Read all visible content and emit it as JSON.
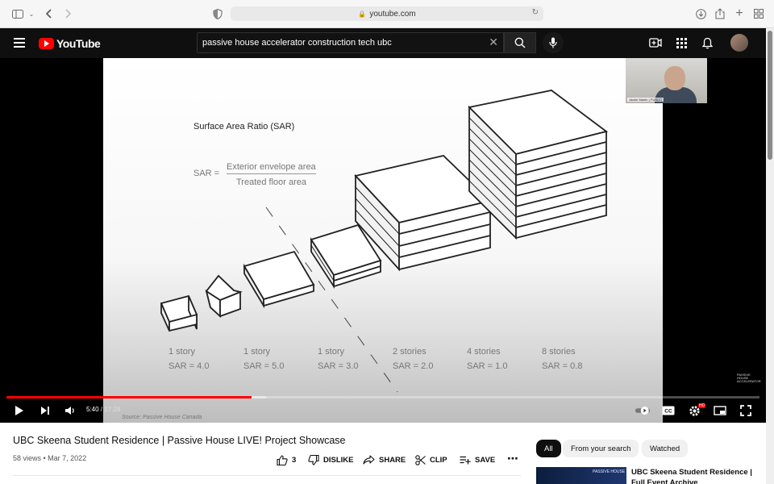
{
  "browser": {
    "url": "youtube.com"
  },
  "masthead": {
    "logo_text": "YouTube",
    "search_query": "passive house accelerator construction tech ubc"
  },
  "player": {
    "current_time": "5:40",
    "duration": " / 17:28",
    "progress_fraction": 0.325,
    "buffer_fraction": 0.345,
    "hd_badge": "HD",
    "webcam_caption": "Jackie Martin | PUBLIC",
    "corner_watermark": "PASSIVE HOUSE ACCELERATOR",
    "source_note": "Source: Passive House Canada",
    "slide": {
      "title": "Surface Area Ratio (SAR)",
      "formula_prefix": "SAR =",
      "numerator": "Exterior envelope area",
      "denominator": "Treated floor area",
      "buildings": [
        {
          "label": "1 story",
          "sar": "SAR = 4.0"
        },
        {
          "label": "1 story",
          "sar": "SAR = 5.0"
        },
        {
          "label": "1 story",
          "sar": "SAR = 3.0"
        },
        {
          "label": "2 stories",
          "sar": "SAR = 2.0"
        },
        {
          "label": "4 stories",
          "sar": "SAR = 1.0"
        },
        {
          "label": "8 stories",
          "sar": "SAR = 0.8"
        }
      ]
    }
  },
  "video": {
    "title": "UBC Skeena Student Residence | Passive House LIVE! Project Showcase",
    "meta": "58 views • Mar 7, 2022",
    "likes": "3",
    "dislike_label": "DISLIKE",
    "share_label": "SHARE",
    "clip_label": "CLIP",
    "save_label": "SAVE"
  },
  "chips": [
    "All",
    "From your search",
    "Watched"
  ],
  "recommendation": {
    "title": "UBC Skeena Student Residence | Full Event Archive",
    "thumb_text": "PASSIVE HOUSE"
  }
}
